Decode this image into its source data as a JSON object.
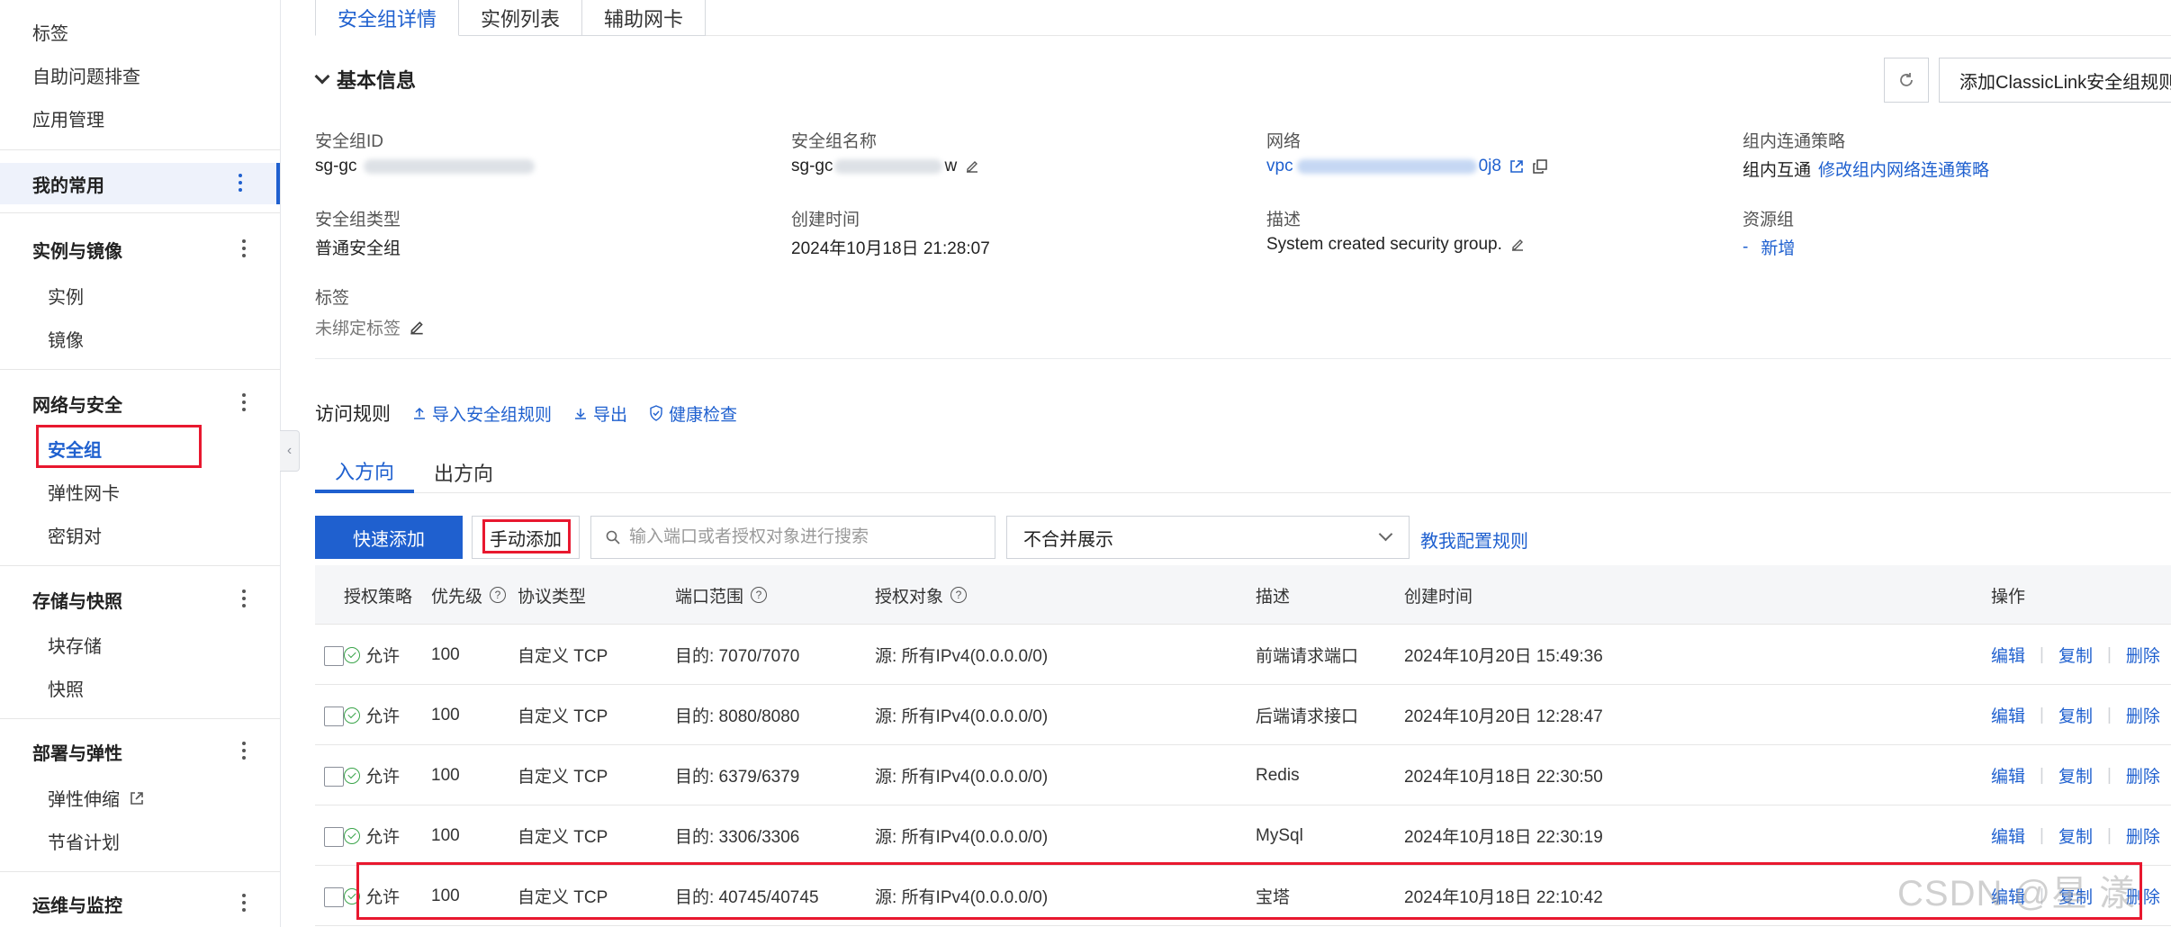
{
  "sidebar": {
    "links": [
      "标签",
      "自助问题排查",
      "应用管理"
    ],
    "favorites": "我的常用",
    "groups": [
      {
        "title": "实例与镜像",
        "items": [
          "实例",
          "镜像"
        ]
      },
      {
        "title": "网络与安全",
        "items": [
          "安全组",
          "弹性网卡",
          "密钥对"
        ]
      },
      {
        "title": "存储与快照",
        "items": [
          "块存储",
          "快照"
        ]
      },
      {
        "title": "部署与弹性",
        "items": [
          "弹性伸缩",
          "节省计划"
        ]
      },
      {
        "title": "运维与监控",
        "items": []
      }
    ],
    "active_item": "安全组"
  },
  "top_tabs": [
    "安全组详情",
    "实例列表",
    "辅助网卡"
  ],
  "basic_info": {
    "title": "基本信息",
    "classic_link_button": "添加ClassicLink安全组规则",
    "fields": {
      "sg_id_label": "安全组ID",
      "sg_id_value_prefix": "sg-gc",
      "sg_name_label": "安全组名称",
      "sg_name_prefix": "sg-gc",
      "sg_name_suffix": "w",
      "network_label": "网络",
      "network_prefix": "vpc",
      "network_suffix": "0j8",
      "intra_label": "组内连通策略",
      "intra_value": "组内互通",
      "intra_link": "修改组内网络连通策略",
      "type_label": "安全组类型",
      "type_value": "普通安全组",
      "created_label": "创建时间",
      "created_value": "2024年10月18日 21:28:07",
      "desc_label": "描述",
      "desc_value": "System created security group.",
      "rg_label": "资源组",
      "rg_value": "-",
      "rg_link": "新增",
      "tags_label": "标签",
      "tags_value": "未绑定标签"
    }
  },
  "rules": {
    "title": "访问规则",
    "actions": [
      "导入安全组规则",
      "导出",
      "健康检查"
    ],
    "direction_tabs": [
      "入方向",
      "出方向"
    ],
    "quick_add": "快速添加",
    "manual_add": "手动添加",
    "search_placeholder": "输入端口或者授权对象进行搜索",
    "merge_select": "不合并展示",
    "help_link": "教我配置规则",
    "columns": [
      "授权策略",
      "优先级",
      "协议类型",
      "端口范围",
      "授权对象",
      "描述",
      "创建时间",
      "操作"
    ],
    "rows": [
      {
        "policy": "允许",
        "priority": "100",
        "protocol": "自定义 TCP",
        "port": "目的: 7070/7070",
        "source": "源: 所有IPv4(0.0.0.0/0)",
        "desc": "前端请求端口",
        "created": "2024年10月20日 15:49:36"
      },
      {
        "policy": "允许",
        "priority": "100",
        "protocol": "自定义 TCP",
        "port": "目的: 8080/8080",
        "source": "源: 所有IPv4(0.0.0.0/0)",
        "desc": "后端请求接口",
        "created": "2024年10月20日 12:28:47"
      },
      {
        "policy": "允许",
        "priority": "100",
        "protocol": "自定义 TCP",
        "port": "目的: 6379/6379",
        "source": "源: 所有IPv4(0.0.0.0/0)",
        "desc": "Redis",
        "created": "2024年10月18日 22:30:50"
      },
      {
        "policy": "允许",
        "priority": "100",
        "protocol": "自定义 TCP",
        "port": "目的: 3306/3306",
        "source": "源: 所有IPv4(0.0.0.0/0)",
        "desc": "MySql",
        "created": "2024年10月18日 22:30:19"
      },
      {
        "policy": "允许",
        "priority": "100",
        "protocol": "自定义 TCP",
        "port": "目的: 40745/40745",
        "source": "源: 所有IPv4(0.0.0.0/0)",
        "desc": "宝塔",
        "created": "2024年10月18日 22:10:42"
      }
    ],
    "row_ops": [
      "编辑",
      "复制",
      "删除"
    ]
  },
  "watermark": "CSDN @星 漾",
  "colors": {
    "accent": "#1f60cf",
    "highlight": "#e8182f",
    "allow": "#3aa44a"
  }
}
